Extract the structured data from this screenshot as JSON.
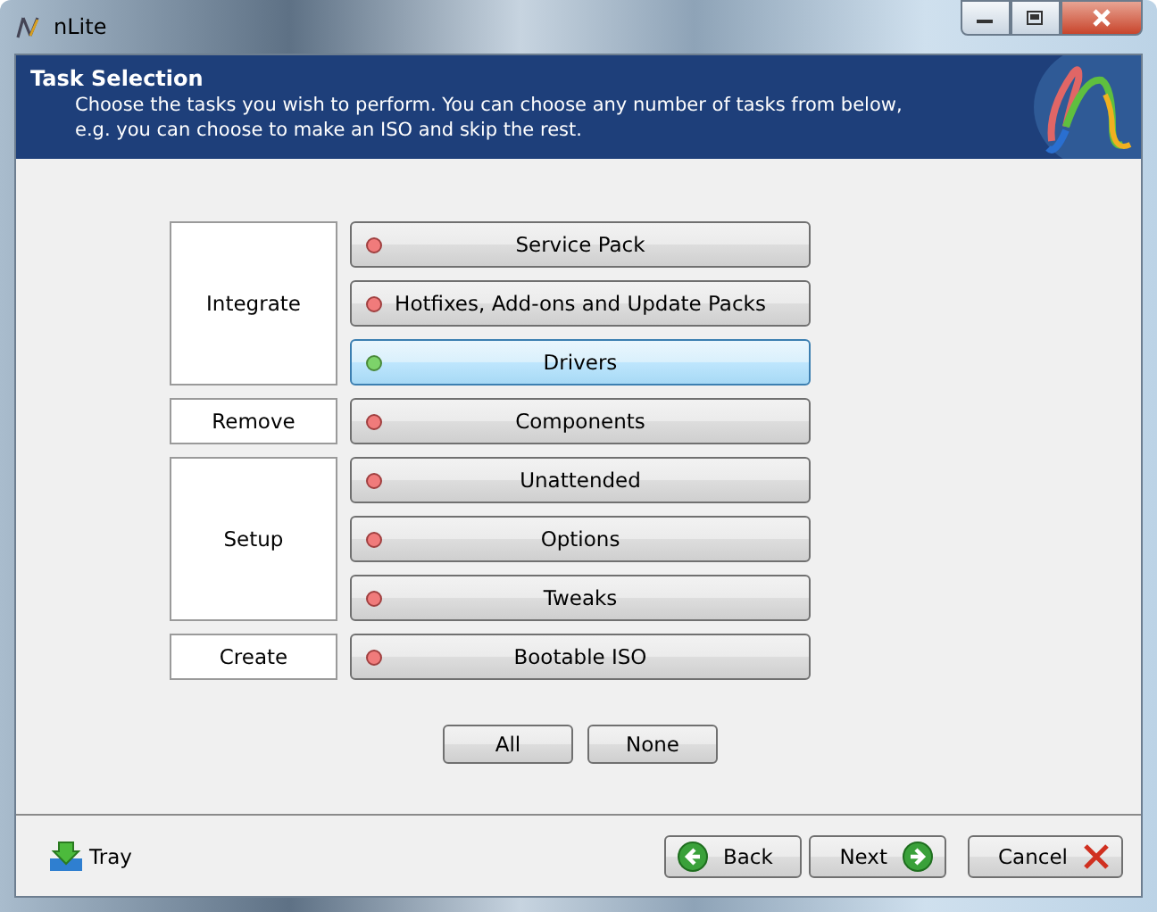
{
  "window": {
    "title": "nLite"
  },
  "header": {
    "title": "Task Selection",
    "description": "Choose the tasks you wish to perform. You can choose any number of tasks from below, e.g. you can choose to make an ISO and skip the rest."
  },
  "groups": [
    {
      "label": "Integrate",
      "tasks": [
        {
          "label": "Service Pack",
          "selected": false
        },
        {
          "label": "Hotfixes, Add-ons and Update Packs",
          "selected": false
        },
        {
          "label": "Drivers",
          "selected": true
        }
      ]
    },
    {
      "label": "Remove",
      "tasks": [
        {
          "label": "Components",
          "selected": false
        }
      ]
    },
    {
      "label": "Setup",
      "tasks": [
        {
          "label": "Unattended",
          "selected": false
        },
        {
          "label": "Options",
          "selected": false
        },
        {
          "label": "Tweaks",
          "selected": false
        }
      ]
    },
    {
      "label": "Create",
      "tasks": [
        {
          "label": "Bootable ISO",
          "selected": false
        }
      ]
    }
  ],
  "select_buttons": [
    "All",
    "None"
  ],
  "footer": {
    "tray": "Tray",
    "back": "Back",
    "next": "Next",
    "cancel": "Cancel"
  }
}
